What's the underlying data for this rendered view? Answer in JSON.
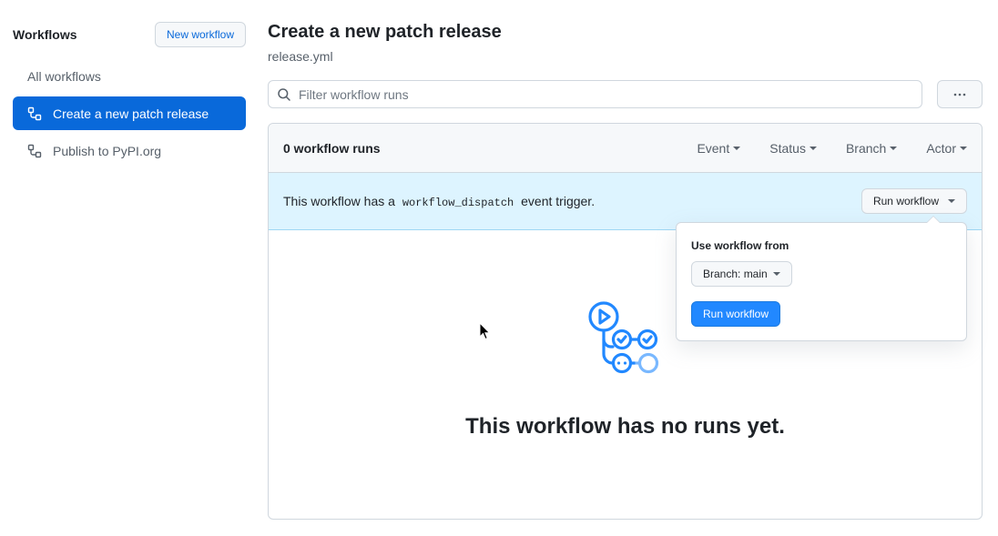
{
  "sidebar": {
    "title": "Workflows",
    "new_workflow_label": "New workflow",
    "items": [
      {
        "label": "All workflows",
        "active": false,
        "icon": null
      },
      {
        "label": "Create a new patch release",
        "active": true,
        "icon": "workflow-icon"
      },
      {
        "label": "Publish to PyPI.org",
        "active": false,
        "icon": "workflow-icon"
      }
    ]
  },
  "header": {
    "title": "Create a new patch release",
    "filename": "release.yml"
  },
  "filter": {
    "placeholder": "Filter workflow runs",
    "value": "",
    "more_icon": "kebab-horizontal-icon"
  },
  "runs": {
    "count_label": "0 workflow runs",
    "filters": [
      "Event",
      "Status",
      "Branch",
      "Actor"
    ]
  },
  "dispatch": {
    "text_before": "This workflow has a",
    "code": "workflow_dispatch",
    "text_after": "event trigger.",
    "run_toggle_label": "Run workflow"
  },
  "popover": {
    "label": "Use workflow from",
    "branch_label": "Branch: main",
    "run_button_label": "Run workflow"
  },
  "empty_state": {
    "icon": "actions-workflow-logo-icon",
    "title": "This workflow has no runs yet."
  },
  "colors": {
    "accent": "#0969da",
    "primary_button": "#2188ff",
    "banner_bg": "#ddf4ff"
  }
}
